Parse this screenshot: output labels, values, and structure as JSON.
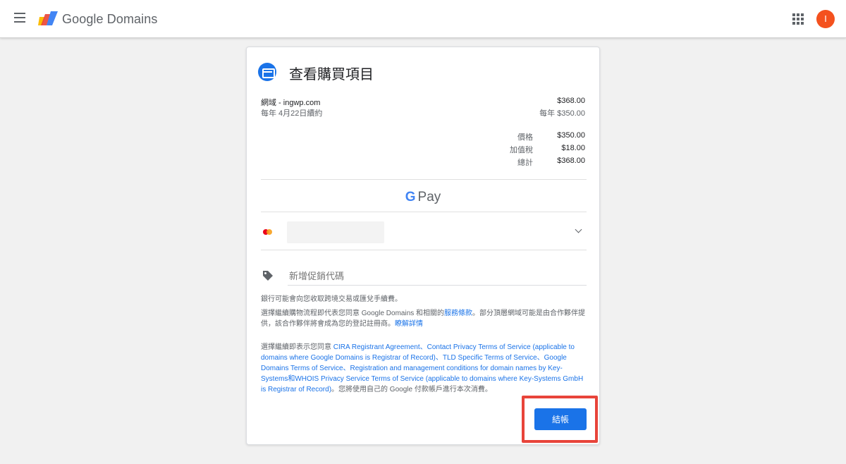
{
  "header": {
    "brand": "Google Domains",
    "avatar_letter": "I",
    "avatar_color": "#f4511e"
  },
  "card": {
    "title": "查看購買項目",
    "item": {
      "name": "網域 - ingwp.com",
      "renewal": "每年 4月22日續約",
      "price": "$368.00",
      "renewal_price": "每年 $350.00"
    },
    "summary": [
      {
        "label": "價格",
        "value": "$350.00"
      },
      {
        "label": "加值稅",
        "value": "$18.00"
      },
      {
        "label": "總計",
        "value": "$368.00"
      }
    ],
    "gpay_label": "Pay",
    "promo_placeholder": "新增促銷代碼",
    "notes": {
      "bank_fee": "銀行可能會向您收取跨境交易或匯兌手續費。",
      "agree_prefix": "選擇繼續購物流程即代表您同意 Google Domains 和相關的",
      "terms_link": "服務條款",
      "agree_suffix": "。部分頂層網域可能是由合作夥伴提供，該合作夥伴將會成為您的登記註冊商。",
      "learn_more": "瞭解詳情",
      "legal_prefix": "選擇繼續即表示您同意 ",
      "legal_links": "CIRA Registrant Agreement、Contact Privacy Terms of Service (applicable to domains where Google Domains is Registrar of Record)、TLD Specific Terms of Service、Google Domains Terms of Service、Registration and management conditions for domain names by Key-Systems和WHOIS Privacy Service Terms of Service (applicable to domains where Key-Systems GmbH is Registrar of Record)",
      "legal_suffix": "。您將使用自己的 Google 付款帳戶進行本次消費。"
    },
    "checkout_label": "結帳"
  },
  "colors": {
    "accent": "#1a73e8",
    "highlight": "#e8443a"
  },
  "icons": [
    "menu-icon",
    "google-domains-logo-icon",
    "apps-grid-icon",
    "credit-card-icon",
    "google-g-icon",
    "mastercard-icon",
    "chevron-down-icon",
    "tag-icon"
  ]
}
